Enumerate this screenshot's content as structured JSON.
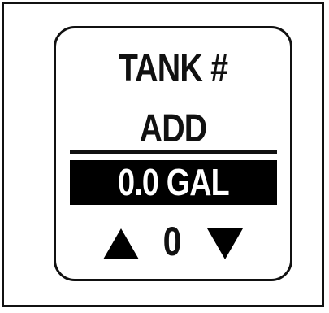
{
  "display": {
    "title": "TANK #",
    "subtitle": "ADD",
    "value": "0.0 GAL",
    "tank_number": "0"
  },
  "controls": {
    "up_icon": "triangle-up-icon",
    "down_icon": "triangle-down-icon"
  },
  "colors": {
    "foreground": "#111111",
    "background": "#ffffff",
    "highlight_bar": "#000000",
    "highlight_text": "#ffffff"
  }
}
